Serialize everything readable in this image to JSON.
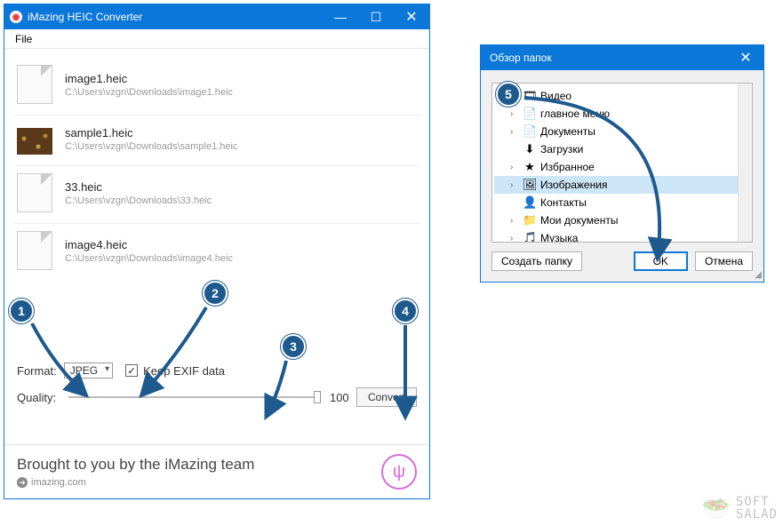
{
  "main_window": {
    "title": "iMazing HEIC Converter",
    "menu": {
      "file": "File"
    },
    "files": [
      {
        "name": "image1.heic",
        "path": "C:\\Users\\vzgn\\Downloads\\image1.heic",
        "thumb": "blank"
      },
      {
        "name": "sample1.heic",
        "path": "C:\\Users\\vzgn\\Downloads\\sample1.heic",
        "thumb": "sample"
      },
      {
        "name": "33.heic",
        "path": "C:\\Users\\vzgn\\Downloads\\33.heic",
        "thumb": "blank"
      },
      {
        "name": "image4.heic",
        "path": "C:\\Users\\vzgn\\Downloads\\image4.heic",
        "thumb": "blank"
      }
    ],
    "format_label": "Format:",
    "format_value": "JPEG",
    "keep_exif_label": "Keep EXIF data",
    "keep_exif_checked": true,
    "quality_label": "Quality:",
    "quality_value": "100",
    "convert_label": "Convert",
    "footer_line1": "Brought to you by the iMazing team",
    "footer_link": "imazing.com"
  },
  "dialog": {
    "title": "Обзор папок",
    "tree": [
      {
        "icon": "🎞",
        "label": "Видео",
        "caret": ""
      },
      {
        "icon": "📄",
        "label": "главное меню",
        "caret": "›"
      },
      {
        "icon": "📄",
        "label": "Документы",
        "caret": "›"
      },
      {
        "icon": "⬇",
        "label": "Загрузки",
        "caret": ""
      },
      {
        "icon": "★",
        "label": "Избранное",
        "caret": "›"
      },
      {
        "icon": "🖼",
        "label": "Изображения",
        "caret": "›",
        "selected": true
      },
      {
        "icon": "👤",
        "label": "Контакты",
        "caret": ""
      },
      {
        "icon": "📁",
        "label": "Мои документы",
        "caret": "›"
      },
      {
        "icon": "🎵",
        "label": "Музыка",
        "caret": "›"
      }
    ],
    "btn_create": "Создать папку",
    "btn_ok": "OK",
    "btn_cancel": "Отмена"
  },
  "callouts": [
    "1",
    "2",
    "3",
    "4",
    "5"
  ],
  "watermark": {
    "line1": "SOFT",
    "line2": "SALAD"
  },
  "colors": {
    "accent": "#0b77d8",
    "badge": "#1e5a8e"
  }
}
